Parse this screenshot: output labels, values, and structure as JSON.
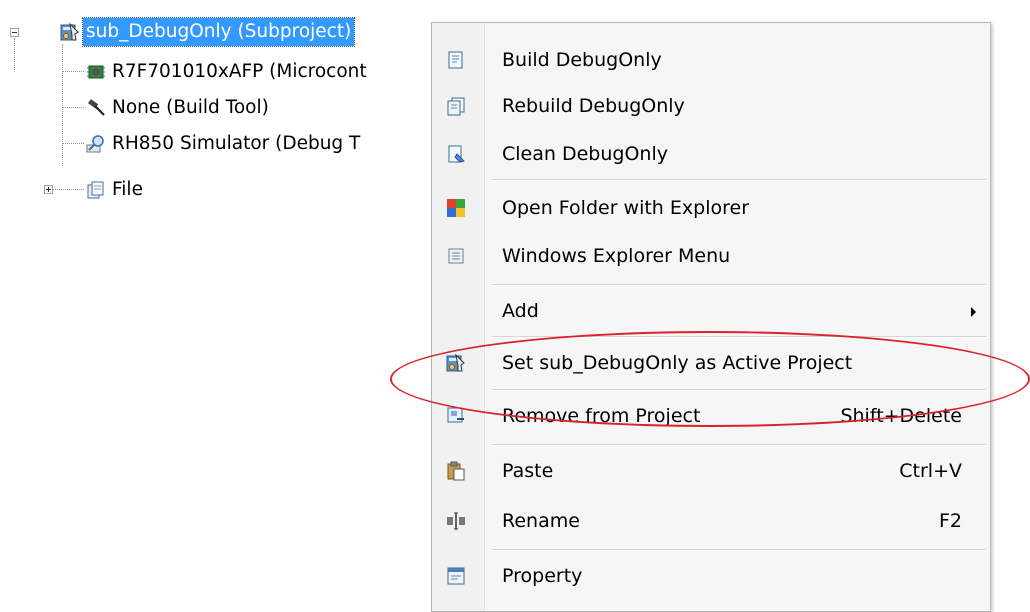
{
  "tree": {
    "root": {
      "label": "sub_DebugOnly (Subproject)",
      "icon": "subproject-icon",
      "expanded": true,
      "selected": true
    },
    "children": [
      {
        "label": "R7F701010xAFP (Microcont",
        "icon": "microcontroller-icon"
      },
      {
        "label": "None (Build Tool)",
        "icon": "hammer-icon"
      },
      {
        "label": "RH850 Simulator (Debug T",
        "icon": "debug-tool-icon"
      },
      {
        "label": "File",
        "icon": "file-folder-icon",
        "expandable": true
      }
    ]
  },
  "menu": {
    "items": [
      {
        "label": "Build DebugOnly",
        "shortcut": "",
        "icon": "build-icon"
      },
      {
        "label": "Rebuild DebugOnly",
        "shortcut": "",
        "icon": "rebuild-icon"
      },
      {
        "label": "Clean DebugOnly",
        "shortcut": "",
        "icon": "clean-icon"
      },
      {
        "label": "Open Folder with Explorer",
        "shortcut": "",
        "icon": "folder-explorer-icon"
      },
      {
        "label": "Windows Explorer Menu",
        "shortcut": "",
        "icon": "explorer-menu-icon"
      },
      {
        "label": "Add",
        "shortcut": "",
        "icon": "",
        "submenu": true
      },
      {
        "label": "Set sub_DebugOnly as Active Project",
        "shortcut": "",
        "icon": "active-project-icon",
        "highlighted_by_annotation": true
      },
      {
        "label": "Remove from Project",
        "shortcut": "Shift+Delete",
        "icon": "remove-icon"
      },
      {
        "label": "Paste",
        "shortcut": "Ctrl+V",
        "icon": "paste-icon"
      },
      {
        "label": "Rename",
        "shortcut": "F2",
        "icon": "rename-icon"
      },
      {
        "label": "Property",
        "shortcut": "",
        "icon": "property-icon"
      }
    ]
  },
  "colors": {
    "selection": "#3399ff",
    "annotation": "#d8232a",
    "menu_background": "#f6f6f6"
  }
}
